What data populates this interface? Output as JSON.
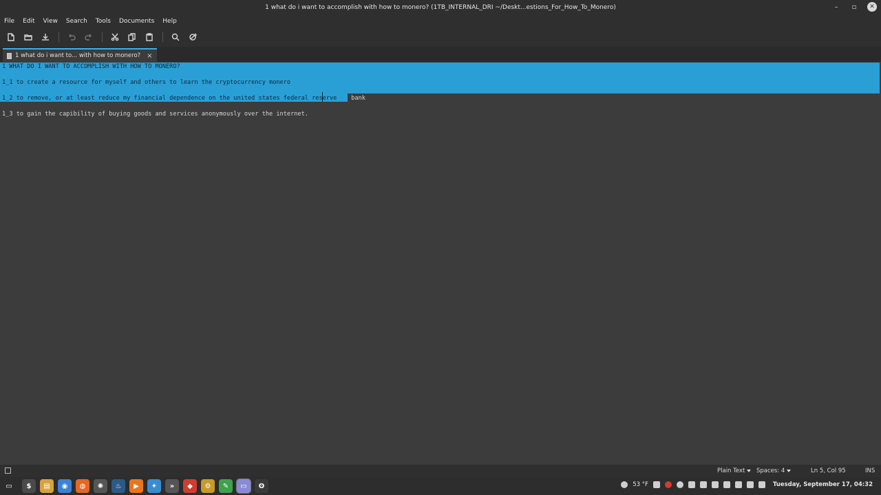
{
  "window": {
    "title": "1 what do i want to accomplish with how to monero? (1TB_INTERNAL_DRI ~/Deskt...estions_For_How_To_Monero)",
    "min": "–",
    "max": "▫",
    "close": "✕"
  },
  "menu": [
    "File",
    "Edit",
    "View",
    "Search",
    "Tools",
    "Documents",
    "Help"
  ],
  "toolbar": {
    "icons": [
      "new-document-icon",
      "open-icon",
      "save-icon",
      "undo-icon",
      "redo-icon",
      "cut-icon",
      "copy-icon",
      "paste-icon",
      "search-icon",
      "replace-icon"
    ]
  },
  "tab": {
    "label": "1 what do i want to... with how to monero?",
    "close": "×"
  },
  "editor": {
    "lines": [
      "1 WHAT DO I WANT TO ACCOMPLISH WITH HOW TO MONERO?",
      "1_1 to create a resource for myself and others to learn the cryptocurrency monero",
      "1_2 to remove, or at least reduce my financial dependence on the united states federal reserve",
      " bank",
      "1_3 to gain the capibility of buying goods and services anonymously over the internet."
    ]
  },
  "statusbar": {
    "syntax": "Plain Text",
    "indent": "Spaces: 4",
    "position": "Ln 5, Col 95",
    "mode": "INS"
  },
  "taskbar": {
    "weather": "53 °F",
    "clock": "Tuesday, September 17, 04:32",
    "apps": [
      {
        "name": "app-terminal",
        "glyph": "$",
        "color": "#4a4a4a"
      },
      {
        "name": "app-files",
        "glyph": "▤",
        "color": "#d8a33a"
      },
      {
        "name": "app-chrome",
        "glyph": "◉",
        "color": "#3b82d6"
      },
      {
        "name": "app-firefox",
        "glyph": "◍",
        "color": "#e8661f"
      },
      {
        "name": "app-settings",
        "glyph": "✺",
        "color": "#555"
      },
      {
        "name": "app-steam",
        "glyph": "♨",
        "color": "#2c5a86"
      },
      {
        "name": "app-media",
        "glyph": "▶",
        "color": "#e8761f"
      },
      {
        "name": "app-vscode",
        "glyph": "✦",
        "color": "#3a8bd0"
      },
      {
        "name": "app-arrows",
        "glyph": "»",
        "color": "#555"
      },
      {
        "name": "app-red",
        "glyph": "◆",
        "color": "#d33b2e"
      },
      {
        "name": "app-gear",
        "glyph": "⚙",
        "color": "#c79a2a"
      },
      {
        "name": "app-green",
        "glyph": "✎",
        "color": "#3fa14b"
      },
      {
        "name": "app-editor",
        "glyph": "▭",
        "color": "#8a8ad6"
      },
      {
        "name": "app-bluetooth",
        "glyph": "ʘ",
        "color": "#3a3a3a"
      }
    ]
  }
}
